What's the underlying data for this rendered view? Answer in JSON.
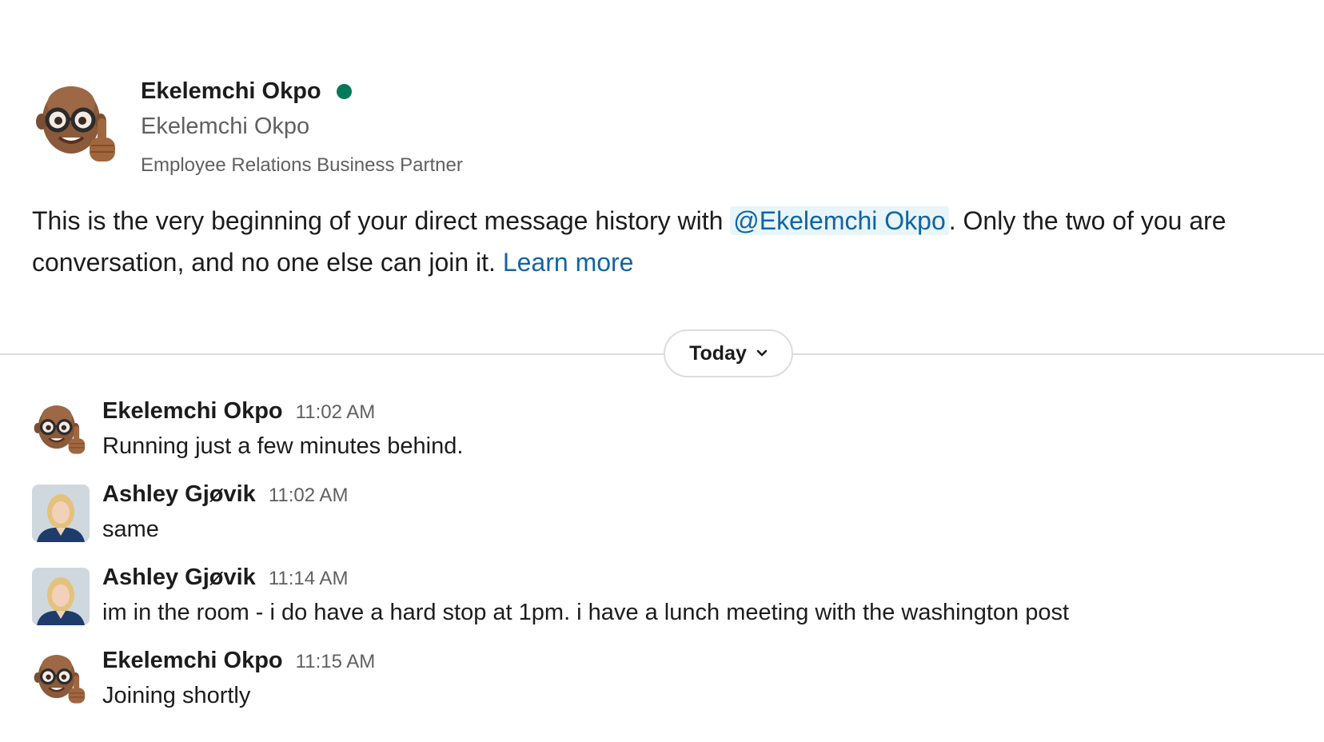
{
  "intro": {
    "avatar_icon": "memoji-thumbs-up-avatar",
    "name": "Ekelemchi Okpo",
    "presence": "active",
    "presence_color": "#007a5a",
    "display_name": "Ekelemchi Okpo",
    "title": "Employee Relations Business Partner",
    "text_before": "This is the very beginning of your direct message history with ",
    "mention": "@Ekelemchi Okpo",
    "text_after": ". Only the two of you are",
    "text_line2": "conversation, and no one else can join it. ",
    "learn_more": "Learn more"
  },
  "divider": {
    "label": "Today",
    "icon": "chevron-down-icon"
  },
  "messages": [
    {
      "sender": "Ekelemchi Okpo",
      "time": "11:02 AM",
      "text": "Running just a few minutes behind.",
      "avatar": "memoji-thumbs-up-avatar"
    },
    {
      "sender": "Ashley Gjøvik",
      "time": "11:02 AM",
      "text": "same",
      "avatar": "photo-avatar"
    },
    {
      "sender": "Ashley Gjøvik",
      "time": "11:14 AM",
      "text": "im in the room - i do have a hard stop at 1pm. i have a lunch meeting with the washington post",
      "avatar": "photo-avatar"
    },
    {
      "sender": "Ekelemchi Okpo",
      "time": "11:15 AM",
      "text": "Joining shortly",
      "avatar": "memoji-thumbs-up-avatar"
    }
  ],
  "colors": {
    "link": "#1264a3",
    "mention_bg": "#e8f5fa",
    "muted_text": "#616061",
    "divider": "#dddddd"
  }
}
